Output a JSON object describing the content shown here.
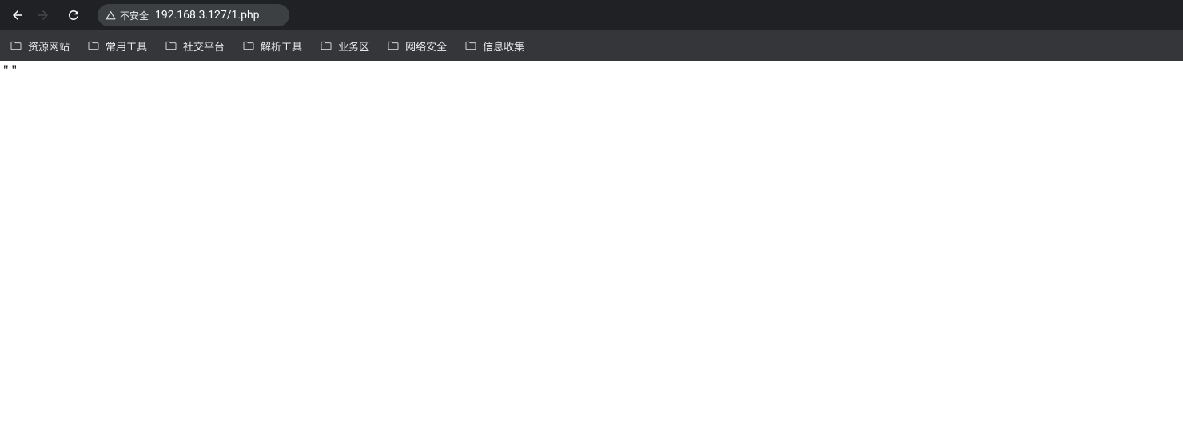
{
  "toolbar": {
    "security_label": "不安全",
    "url": "192.168.3.127/1.php"
  },
  "bookmarks": [
    {
      "label": "资源网站"
    },
    {
      "label": "常用工具"
    },
    {
      "label": "社交平台"
    },
    {
      "label": "解析工具"
    },
    {
      "label": "业务区"
    },
    {
      "label": "网络安全"
    },
    {
      "label": "信息收集"
    }
  ],
  "page": {
    "body_text": "\" \""
  }
}
